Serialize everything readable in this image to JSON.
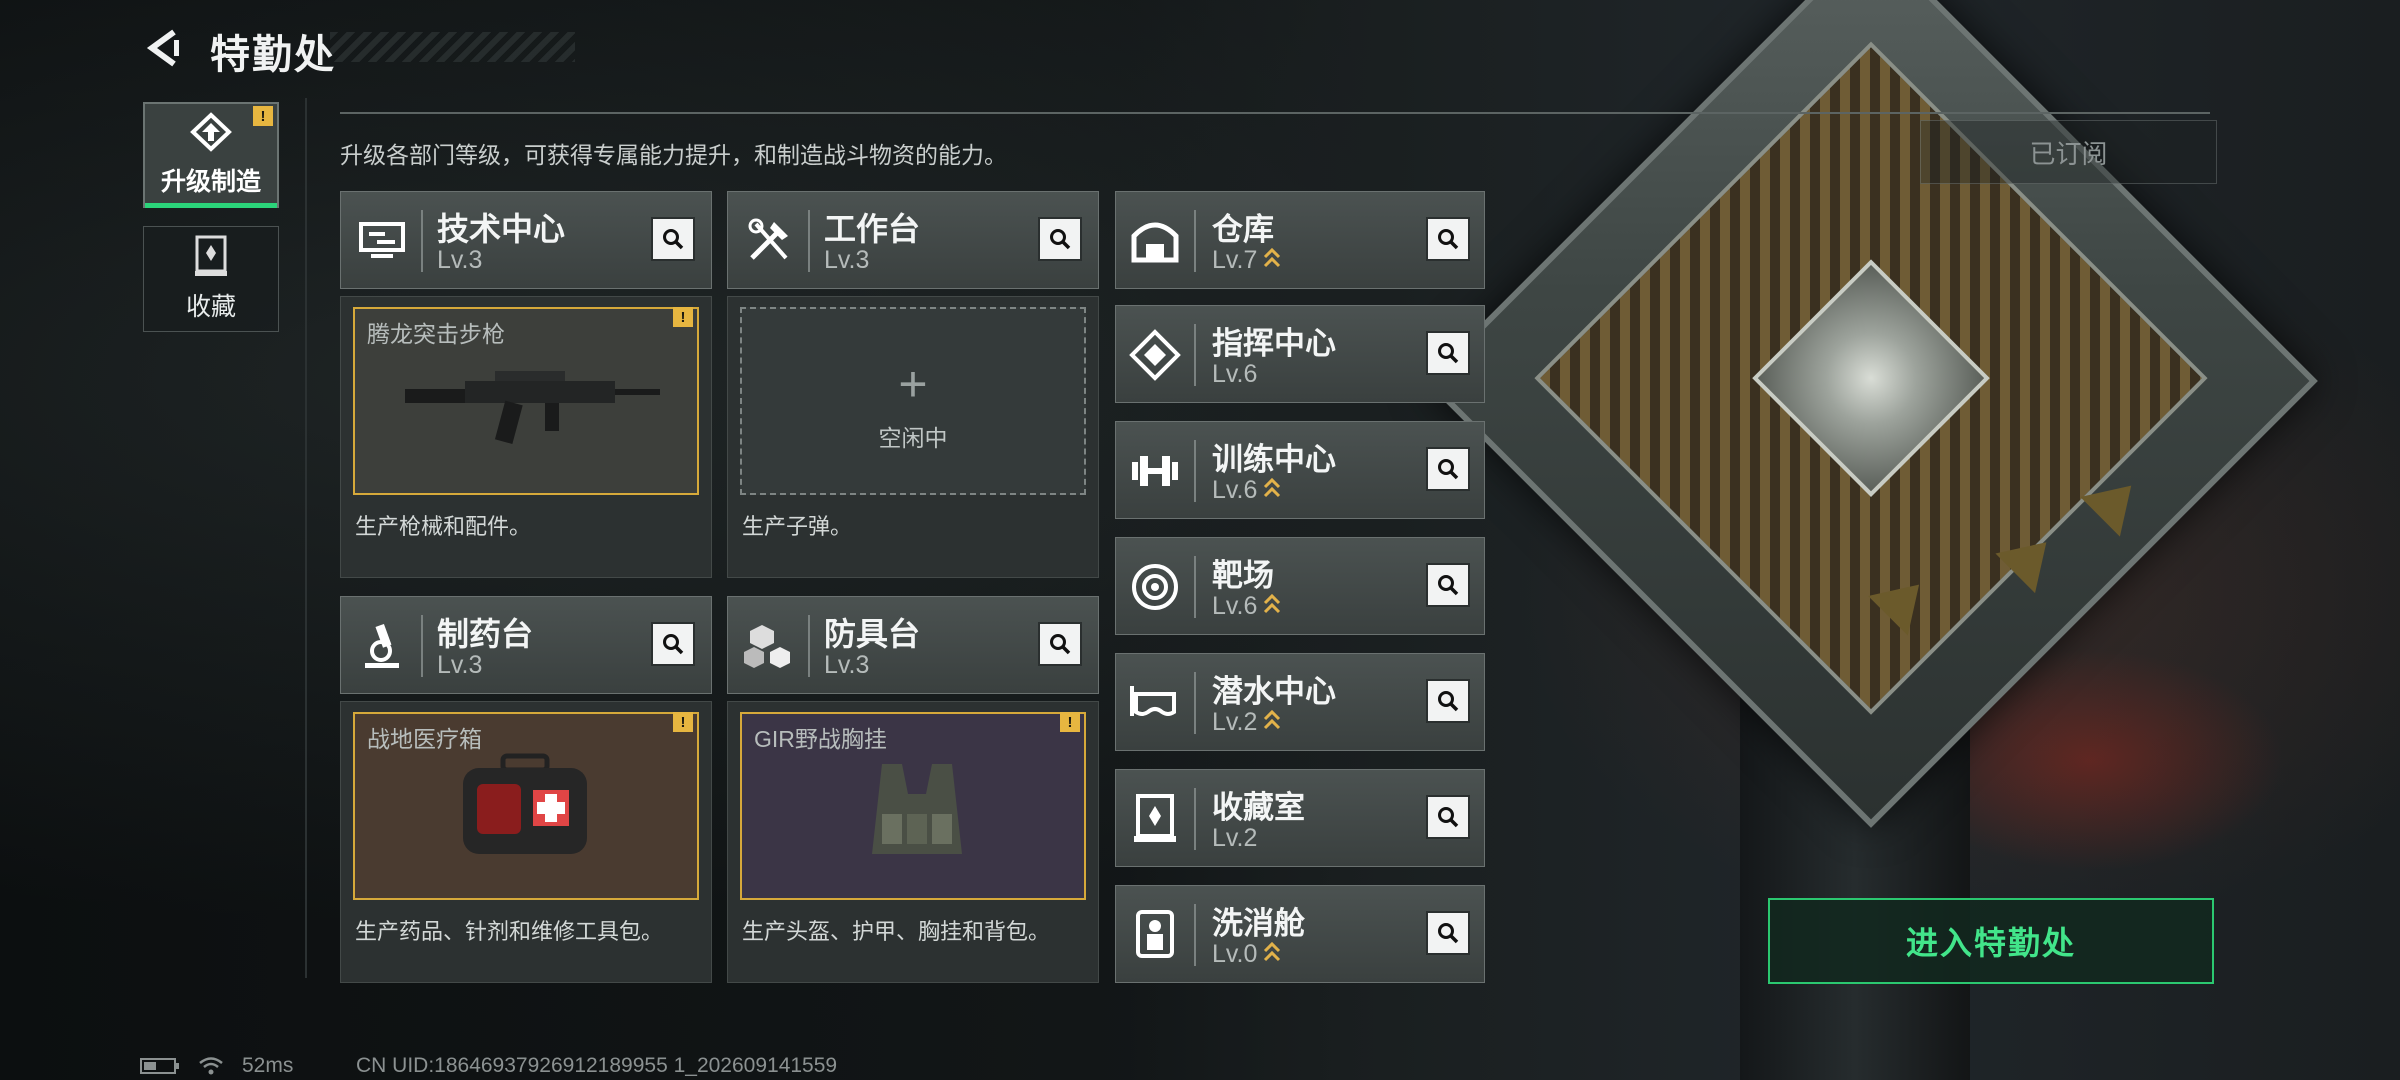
{
  "header": {
    "title": "特勤处"
  },
  "sidebar": {
    "tabs": [
      {
        "label": "升级制造",
        "active": true,
        "warning": "!"
      },
      {
        "label": "收藏",
        "active": false
      }
    ]
  },
  "description": "升级各部门等级，可获得专属能力提升，和制造战斗物资的能力。",
  "subscribed_label": "已订阅",
  "workstations": [
    {
      "name": "技术中心",
      "level": "Lv.3",
      "slot_title": "腾龙突击步枪",
      "slot_state": "producing",
      "warning": "!",
      "body": "生产枪械和配件。"
    },
    {
      "name": "工作台",
      "level": "Lv.3",
      "slot_title": "",
      "slot_state": "idle",
      "idle_label": "空闲中",
      "plus": "+",
      "body": "生产子弹。"
    },
    {
      "name": "制药台",
      "level": "Lv.3",
      "slot_title": "战地医疗箱",
      "slot_state": "producing",
      "warning": "!",
      "body": "生产药品、针剂和维修工具包。"
    },
    {
      "name": "防具台",
      "level": "Lv.3",
      "slot_title": "GIR野战胸挂",
      "slot_state": "producing",
      "warning": "!",
      "body": "生产头盔、护甲、胸挂和背包。"
    }
  ],
  "facilities": [
    {
      "name": "仓库",
      "level": "Lv.7",
      "upgradable": true,
      "icon": "warehouse-icon"
    },
    {
      "name": "指挥中心",
      "level": "Lv.6",
      "upgradable": false,
      "icon": "command-icon"
    },
    {
      "name": "训练中心",
      "level": "Lv.6",
      "upgradable": true,
      "icon": "dumbbell-icon"
    },
    {
      "name": "靶场",
      "level": "Lv.6",
      "upgradable": true,
      "icon": "target-icon"
    },
    {
      "name": "潜水中心",
      "level": "Lv.2",
      "upgradable": true,
      "icon": "diving-mask-icon"
    },
    {
      "name": "收藏室",
      "level": "Lv.2",
      "upgradable": false,
      "icon": "collection-icon"
    },
    {
      "name": "洗消舱",
      "level": "Lv.0",
      "upgradable": true,
      "icon": "decon-icon"
    }
  ],
  "enter_button": "进入特勤处",
  "status": {
    "ping": "52ms",
    "uid": "CN UID:18646937926912189955 1_202609141559"
  },
  "colors": {
    "accent_green": "#2bd47a",
    "warning_yellow": "#e7b640",
    "slot_border": "#d6a93a"
  }
}
